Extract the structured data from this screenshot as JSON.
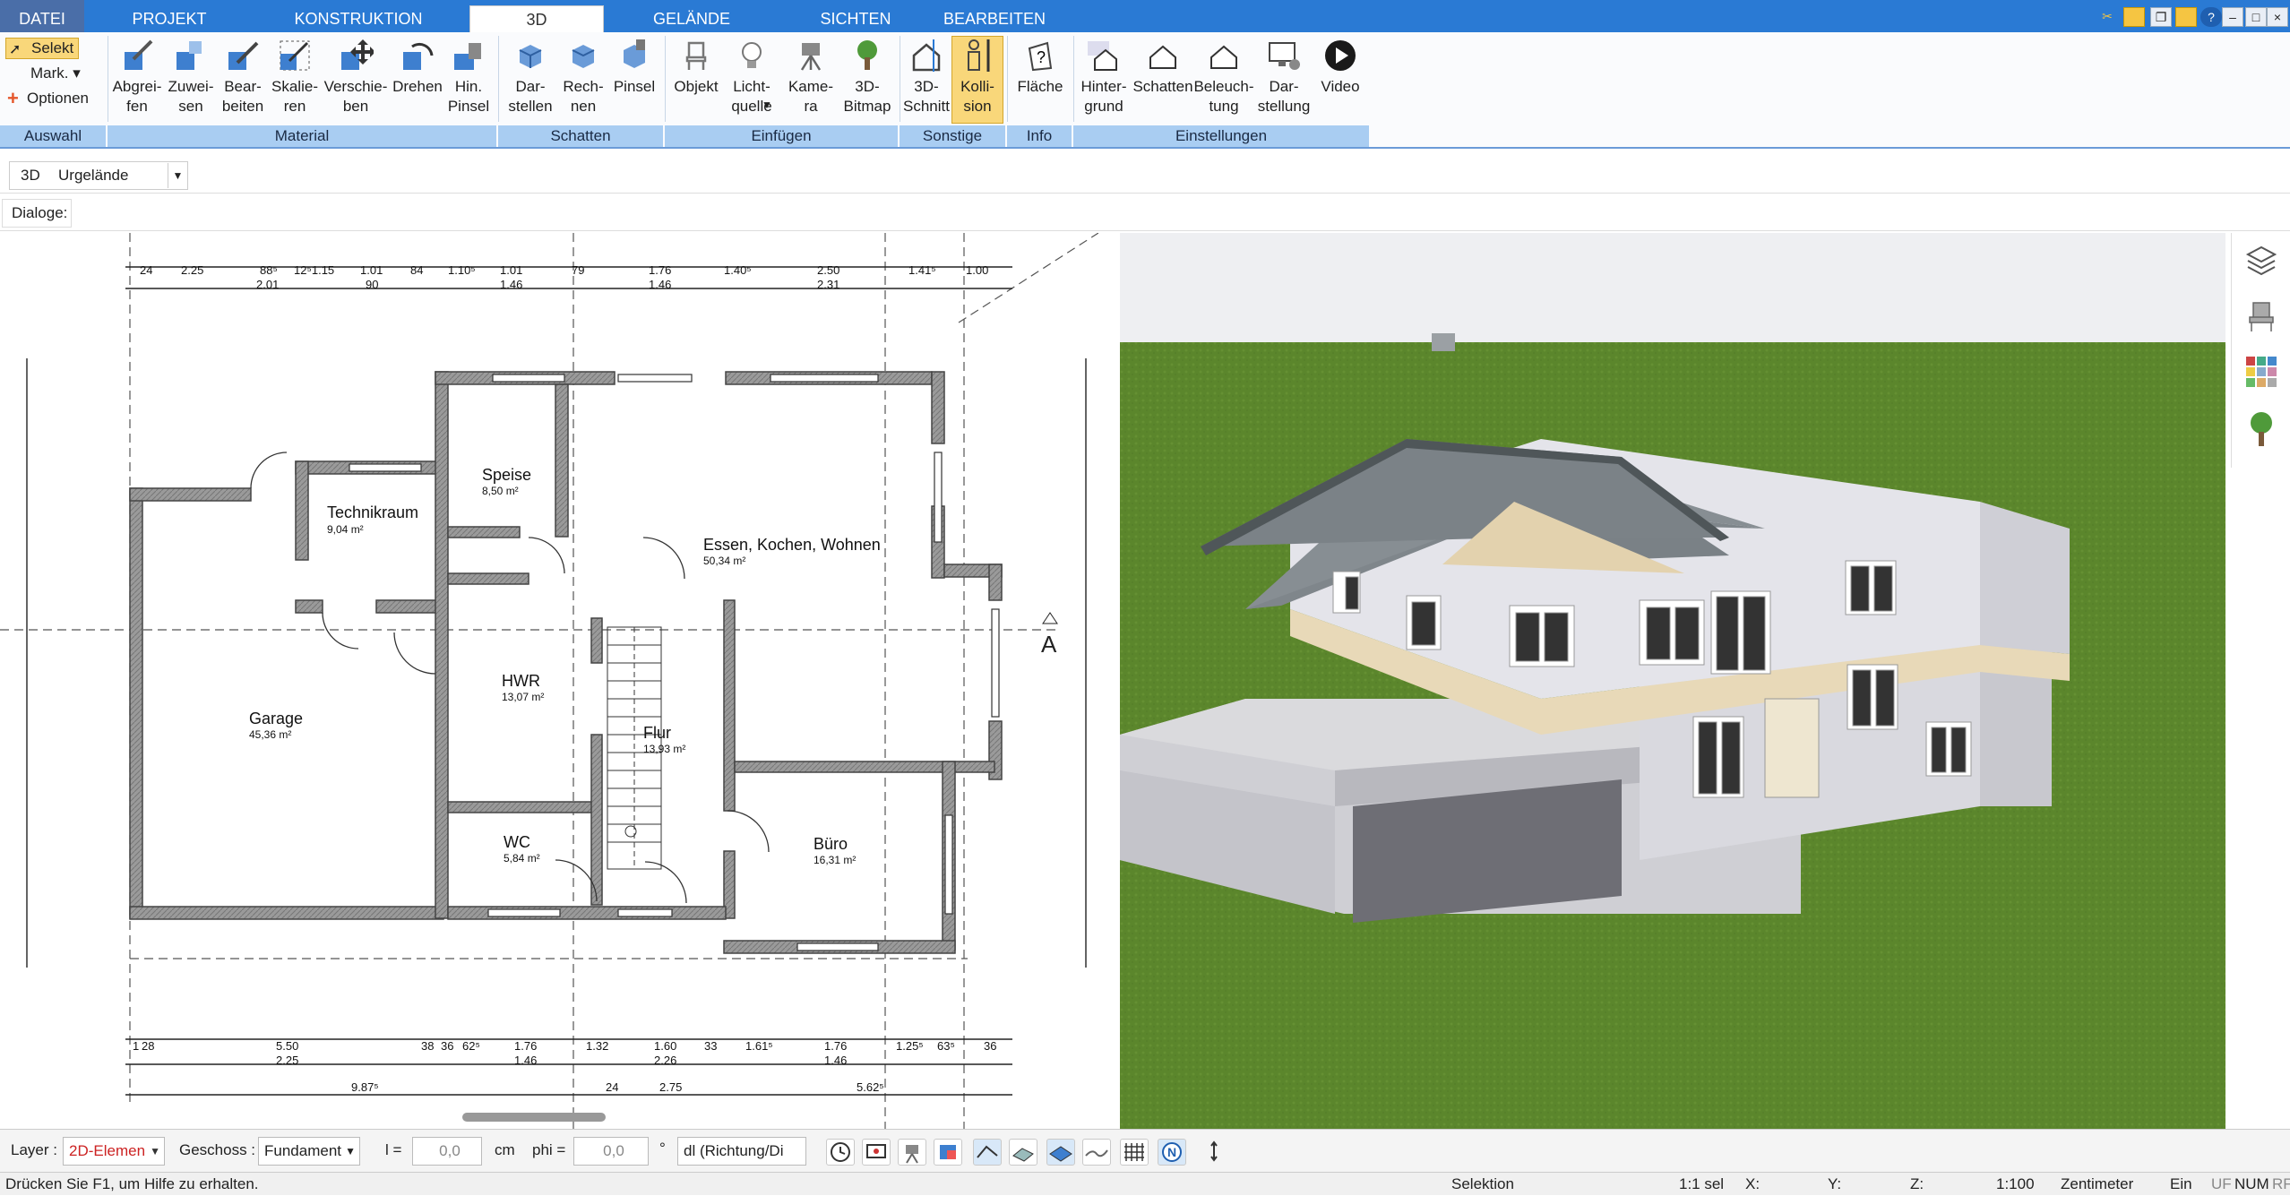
{
  "menu": {
    "tabs": [
      "DATEI",
      "PROJEKT",
      "KONSTRUKTION",
      "3D",
      "GELÄNDE",
      "SICHTEN",
      "BEARBEITEN"
    ],
    "active": "3D"
  },
  "ribbon": {
    "auswahl": {
      "selekt": "Selekt",
      "mark": "Mark.",
      "optionen": "Optionen"
    },
    "buttons": {
      "abgreifen": "Abgrei-\nfen",
      "zuweisen": "Zuwei-\nsen",
      "bearbeiten": "Bear-\nbeiten",
      "skalieren": "Skalie-\nren",
      "verschieben": "Verschie-\nben",
      "drehen": "Drehen",
      "hinpinsel": "Hin.\nPinsel",
      "darstellen": "Dar-\nstellen",
      "rechnen": "Rech-\nnen",
      "pinsel": "Pinsel",
      "objekt": "Objekt",
      "lichtquelle": "Licht-\nquelle",
      "kamera": "Kame-\nra",
      "bitmap": "3D-\nBitmap",
      "schnitt": "3D-\nSchnitt",
      "kollision": "Kolli-\nsion",
      "flaeche": "Fläche",
      "hintergrund": "Hinter-\ngrund",
      "schatten": "Schatten",
      "beleuchtung": "Beleuch-\ntung",
      "darstellung": "Dar-\nstellung",
      "video": "Video"
    },
    "groups": {
      "auswahl": "Auswahl",
      "material": "Material",
      "schatten": "Schatten",
      "einfuegen": "Einfügen",
      "sonstige": "Sonstige",
      "info": "Info",
      "einstellungen": "Einstellungen"
    }
  },
  "toolbar2": {
    "mode": "3D",
    "terrain": "Urgelände"
  },
  "toolbar3": {
    "dialoge": "Dialoge:"
  },
  "rooms": [
    {
      "name": "Technikraum",
      "area": "9,04 m²"
    },
    {
      "name": "Speise",
      "area": "8,50 m²"
    },
    {
      "name": "Essen, Kochen, Wohnen",
      "area": "50,34 m²"
    },
    {
      "name": "Garage",
      "area": "45,36 m²"
    },
    {
      "name": "HWR",
      "area": "13,07 m²"
    },
    {
      "name": "Flur",
      "area": "13,93 m²"
    },
    {
      "name": "WC",
      "area": "5,84 m²"
    },
    {
      "name": "Büro",
      "area": "16,31 m²"
    }
  ],
  "dims_top": [
    "24",
    "2.25",
    "88⁵",
    "12⁵1.15",
    "1.01",
    "84",
    "1.10⁵",
    "1.01",
    "79",
    "1.76",
    "1.40⁵",
    "2.50",
    "1.41⁵",
    "1.00"
  ],
  "dims_top_sub": [
    "2.01",
    "90",
    "1.46",
    "1.46",
    "2.31"
  ],
  "dims_bottom": [
    "1",
    "28",
    "5.50",
    "38",
    "36",
    "62⁵",
    "1.76",
    "1.32",
    "1.60",
    "33",
    "1.61⁵",
    "1.76",
    "1.25⁵",
    "63⁵",
    "36"
  ],
  "dims_bottom_sub": [
    "2.25",
    "1.46",
    "2.26",
    "1.46"
  ],
  "dims_bottom2": [
    "9.87⁵",
    "24",
    "2.75",
    "5.62⁵"
  ],
  "section_mark": "A",
  "status_controls": {
    "layer_label": "Layer :",
    "layer_value": "2D-Elemen",
    "geschoss_label": "Geschoss :",
    "geschoss_value": "Fundament",
    "l_label": "l =",
    "l_value": "0,0",
    "l_unit": "cm",
    "phi_label": "phi =",
    "phi_value": "0,0",
    "phi_unit": "°",
    "dl_value": "dl (Richtung/Di"
  },
  "statusbar": {
    "help": "Drücken Sie F1, um Hilfe zu erhalten.",
    "mode": "Selektion",
    "sel": "1:1 sel",
    "x": "X:",
    "y": "Y:",
    "z": "Z:",
    "scale": "1:100",
    "unit": "Zentimeter",
    "ein": "Ein",
    "uf": "UF",
    "num": "NUM",
    "rf": "RF"
  },
  "colors": {
    "menubar": "#2a7ad4",
    "ribbon_group": "#a9cdf2",
    "active_button": "#f9d77a",
    "grass": "#5f8a2e",
    "roof": "#7f868b"
  }
}
